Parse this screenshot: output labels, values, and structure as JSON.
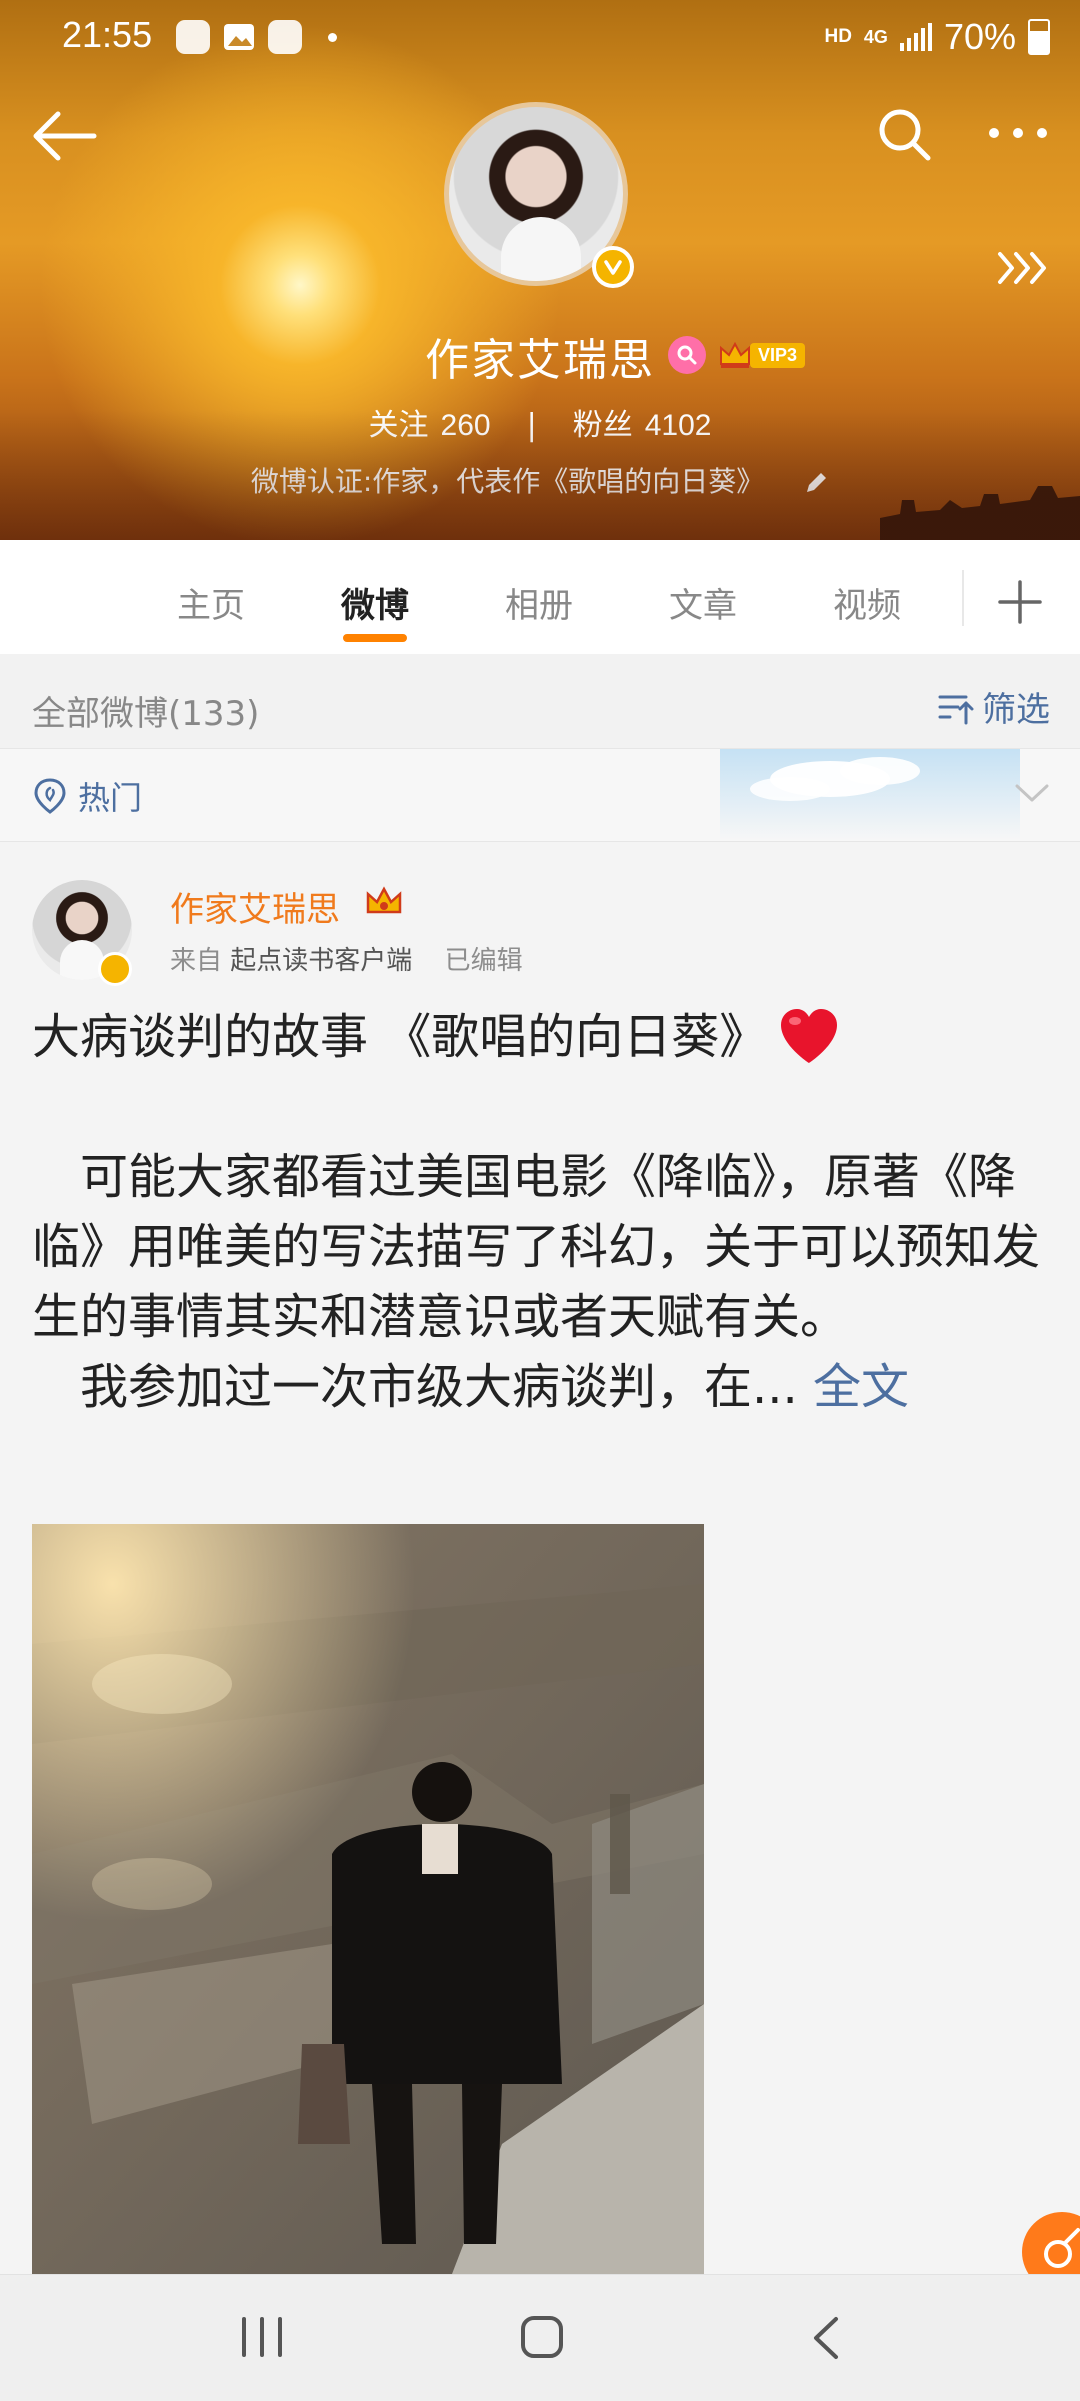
{
  "status_bar": {
    "time": "21:55",
    "hd_label": "HD",
    "network_label": "4G",
    "battery_percent": "70%",
    "battery_level": 0.7,
    "left_icons": [
      "check-icon",
      "gallery-icon",
      "check-icon",
      "dot-icon"
    ]
  },
  "profile": {
    "name": "作家艾瑞思",
    "vip_label": "VIP3",
    "following_label": "关注",
    "following_count": "260",
    "separator": "|",
    "followers_label": "粉丝",
    "followers_count": "4102",
    "certification": "微博认证:作家，代表作《歌唱的向日葵》"
  },
  "tabs": [
    {
      "label": "主页",
      "active": false
    },
    {
      "label": "微博",
      "active": true
    },
    {
      "label": "相册",
      "active": false
    },
    {
      "label": "文章",
      "active": false
    },
    {
      "label": "视频",
      "active": false
    }
  ],
  "filter": {
    "title": "全部微博(133)",
    "button_label": "筛选",
    "hot_label": "热门"
  },
  "post": {
    "author": "作家艾瑞思",
    "source_prefix": "来自",
    "source_app": "起点读书客户端",
    "edited_label": "已编辑",
    "title": "大病谈判的故事 《歌唱的向日葵》",
    "paragraph1": "可能大家都看过美国电影《降临》，原著《降临》用唯美的写法描写了科幻，关于可以预知发生的事情其实和潜意识或者天赋有关。",
    "paragraph2": "我参加过一次市级大病谈判，在...",
    "read_more": "全文"
  },
  "colors": {
    "accent": "#ff8200",
    "link": "#4d6fa0",
    "author": "#f07a1c",
    "verified": "#f5b400",
    "heart": "#e8142c"
  }
}
